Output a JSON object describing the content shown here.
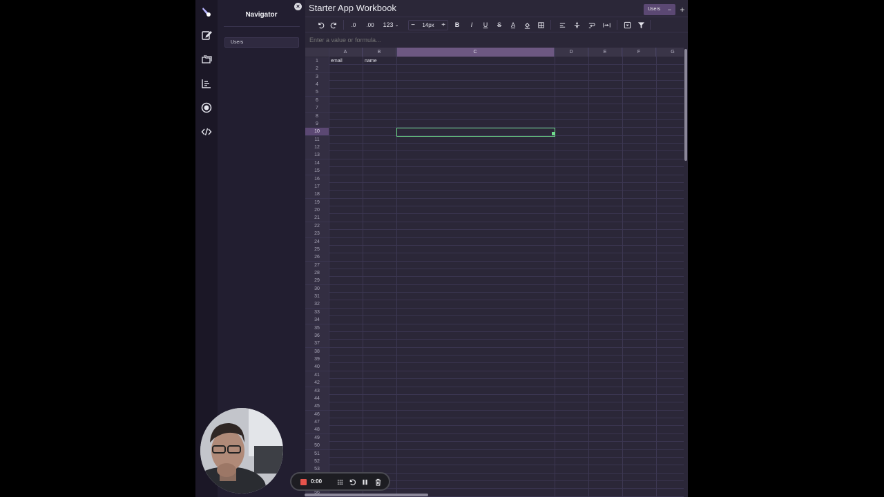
{
  "workbook": {
    "title": "Starter App Workbook"
  },
  "navigator": {
    "title": "Navigator",
    "items": [
      {
        "label": "Users"
      }
    ]
  },
  "sheet_tabs": [
    {
      "label": "Users",
      "action": "−"
    }
  ],
  "add_sheet_label": "+",
  "toolbar": {
    "decrease_decimals": ".0",
    "increase_decimals": ".00",
    "number_format": "123",
    "font_size": "14px",
    "minus": "−",
    "plus": "+",
    "bold": "B",
    "italic": "I",
    "underline": "U",
    "strikethrough": "S",
    "text_color": "A"
  },
  "formula_bar": {
    "placeholder": "Enter a value or formula..."
  },
  "columns": [
    "A",
    "B",
    "C",
    "D",
    "E",
    "F",
    "G"
  ],
  "selected_column": "C",
  "selected_row": 10,
  "cells": {
    "A1": "email",
    "B1": "name"
  },
  "recorder": {
    "time": "0:00"
  },
  "colors": {
    "accent": "#6d5882",
    "selection": "#6fdc8c",
    "record": "#e5534b"
  }
}
